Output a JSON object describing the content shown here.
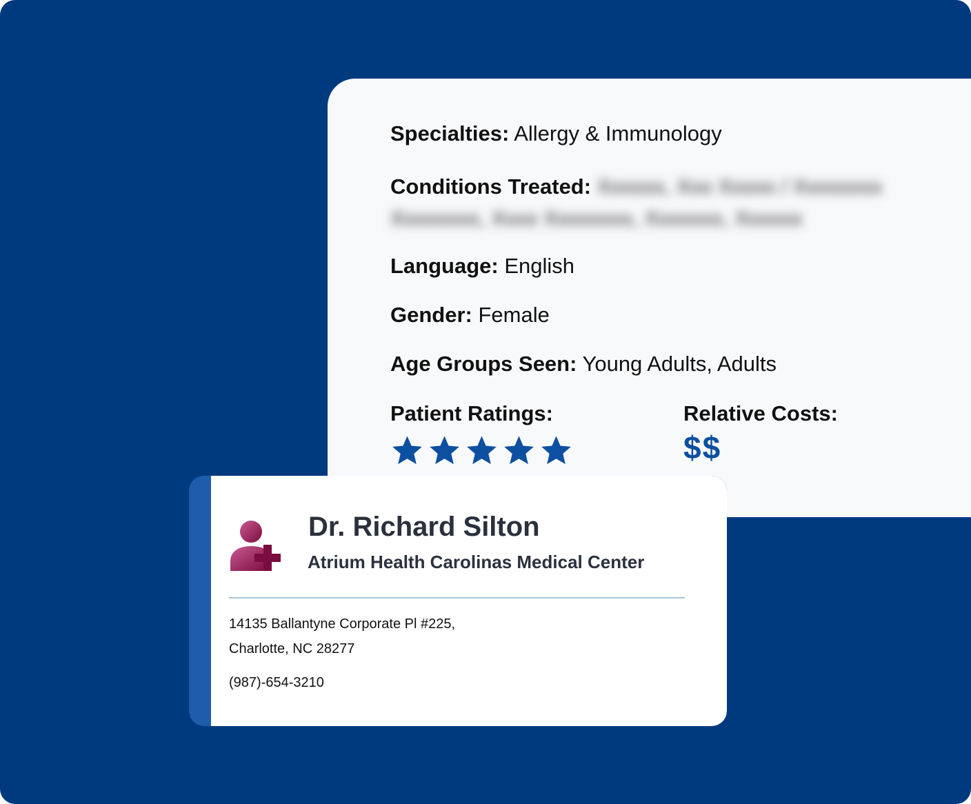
{
  "details": {
    "specialties_label": "Specialties:",
    "specialties_value": "Allergy & Immunology",
    "conditions_label": "Conditions Treated:",
    "language_label": "Language:",
    "language_value": "English",
    "gender_label": "Gender:",
    "gender_value": "Female",
    "age_label": "Age Groups Seen:",
    "age_value": "Young Adults, Adults",
    "ratings_label": "Patient Ratings:",
    "rating_stars": 5,
    "rating_max": 5,
    "costs_label": "Relative Costs:",
    "costs_value": "$$"
  },
  "provider": {
    "icon": "doctor-add-icon",
    "name": "Dr. Richard Silton",
    "facility": "Atrium Health Carolinas Medical Center",
    "address_line1": "14135 Ballantyne Corporate Pl #225,",
    "address_line2": "Charlotte, NC 28277",
    "phone": "(987)-654-3210"
  },
  "colors": {
    "background": "#003a7e",
    "accent_blue": "#0d4fa0",
    "card_stripe": "#1d5dab",
    "icon_gradient_start": "#c04f86",
    "icon_gradient_end": "#7a0c3f"
  }
}
